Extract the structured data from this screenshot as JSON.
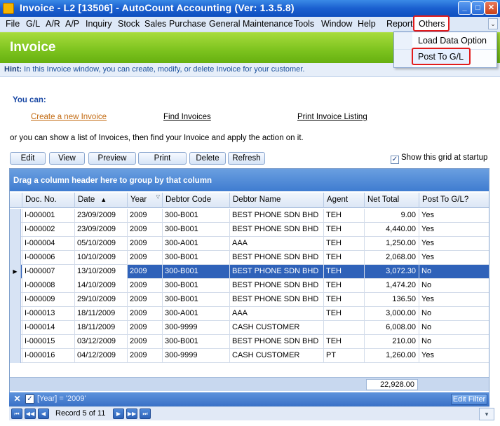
{
  "window": {
    "title": "Invoice - L2 [13506] - AutoCount Accounting (Ver: 1.3.5.8)",
    "min_glyph": "_",
    "max_glyph": "□",
    "close_glyph": "✕"
  },
  "menu": {
    "items": [
      "File",
      "G/L",
      "A/R",
      "A/P",
      "Inquiry",
      "Stock",
      "Sales",
      "Purchase",
      "General Maintenance",
      "Tools",
      "Window",
      "Help",
      "Report"
    ],
    "others": "Others",
    "chevron": "⌄"
  },
  "dropdown": {
    "items": [
      "Load Data Option",
      "Post To G/L"
    ]
  },
  "banner": {
    "title": "Invoice"
  },
  "hint": {
    "label": "Hint:",
    "text": "In this Invoice window, you can create, modify, or delete Invoice for your customer."
  },
  "actions": {
    "you_can": "You can:",
    "create": "Create a new Invoice",
    "find": "Find Invoices",
    "print_listing": "Print Invoice Listing",
    "or_text": "or you can show a list of Invoices, then find your Invoice and apply the action on it."
  },
  "toolbar": {
    "edit": "Edit",
    "view": "View",
    "preview": "Preview",
    "print": "Print",
    "delete": "Delete",
    "refresh": "Refresh",
    "show_grid_label": "Show this grid at startup",
    "show_grid_checked": true
  },
  "grid": {
    "group_panel_text": "Drag a column header here to group by that column",
    "columns": [
      "Doc. No.",
      "Date",
      "Year",
      "Debtor Code",
      "Debtor Name",
      "Agent",
      "Net Total",
      "Post To G/L?"
    ],
    "rows": [
      [
        "I-000001",
        "23/09/2009",
        "2009",
        "300-B001",
        "BEST PHONE SDN BHD",
        "TEH",
        "9.00",
        "Yes"
      ],
      [
        "I-000002",
        "23/09/2009",
        "2009",
        "300-B001",
        "BEST PHONE SDN BHD",
        "TEH",
        "4,440.00",
        "Yes"
      ],
      [
        "I-000004",
        "05/10/2009",
        "2009",
        "300-A001",
        "AAA",
        "TEH",
        "1,250.00",
        "Yes"
      ],
      [
        "I-000006",
        "10/10/2009",
        "2009",
        "300-B001",
        "BEST PHONE SDN BHD",
        "TEH",
        "2,068.00",
        "Yes"
      ],
      [
        "I-000007",
        "13/10/2009",
        "2009",
        "300-B001",
        "BEST PHONE SDN BHD",
        "TEH",
        "3,072.30",
        "No"
      ],
      [
        "I-000008",
        "14/10/2009",
        "2009",
        "300-B001",
        "BEST PHONE SDN BHD",
        "TEH",
        "1,474.20",
        "No"
      ],
      [
        "I-000009",
        "29/10/2009",
        "2009",
        "300-B001",
        "BEST PHONE SDN BHD",
        "TEH",
        "136.50",
        "Yes"
      ],
      [
        "I-000013",
        "18/11/2009",
        "2009",
        "300-A001",
        "AAA",
        "TEH",
        "3,000.00",
        "No"
      ],
      [
        "I-000014",
        "18/11/2009",
        "2009",
        "300-9999",
        "CASH CUSTOMER",
        "",
        "6,008.00",
        "No"
      ],
      [
        "I-000015",
        "03/12/2009",
        "2009",
        "300-B001",
        "BEST PHONE SDN BHD",
        "TEH",
        "210.00",
        "No"
      ],
      [
        "I-000016",
        "04/12/2009",
        "2009",
        "300-9999",
        "CASH CUSTOMER",
        "PT",
        "1,260.00",
        "Yes"
      ]
    ],
    "selected_row_index": 4,
    "total": "22,928.00"
  },
  "filter": {
    "text": "[Year] = '2009'",
    "edit_button": "Edit Filter"
  },
  "navigator": {
    "record_text": "Record 5 of 11"
  },
  "colors": {
    "banner_green": "#7cc21e",
    "selection_blue": "#2f62b9",
    "highlight_red": "#e21b1b",
    "title_blue": "#1a5fcf"
  }
}
